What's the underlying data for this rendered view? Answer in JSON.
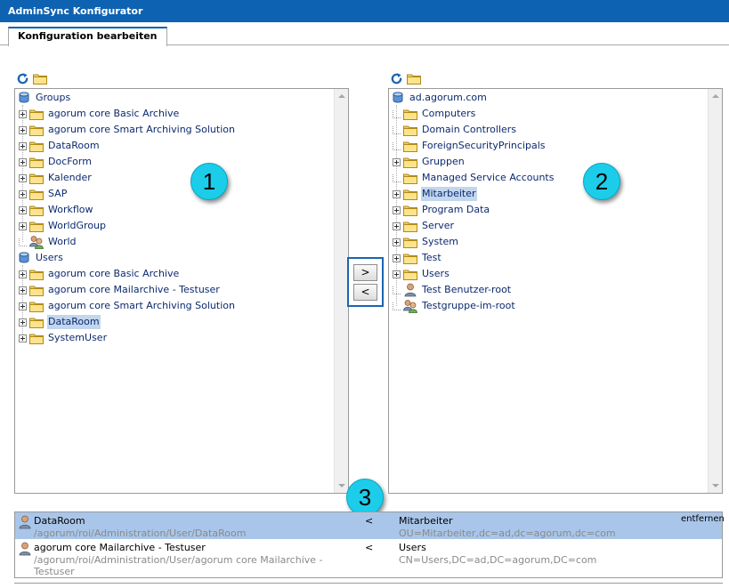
{
  "app": {
    "title": "AdminSync Konfigurator"
  },
  "tabs": [
    {
      "label": "Konfiguration bearbeiten"
    }
  ],
  "left_tree": {
    "rows": [
      {
        "label": "Groups",
        "icon": "server-icon",
        "level": 0,
        "expander": "none"
      },
      {
        "label": "agorum core Basic Archive",
        "icon": "folder-icon",
        "level": 1,
        "expander": "plus"
      },
      {
        "label": "agorum core Smart Archiving Solution",
        "icon": "folder-icon",
        "level": 1,
        "expander": "plus"
      },
      {
        "label": "DataRoom",
        "icon": "folder-icon",
        "level": 1,
        "expander": "plus"
      },
      {
        "label": "DocForm",
        "icon": "folder-icon",
        "level": 1,
        "expander": "plus"
      },
      {
        "label": "Kalender",
        "icon": "folder-icon",
        "level": 1,
        "expander": "plus"
      },
      {
        "label": "SAP",
        "icon": "folder-icon",
        "level": 1,
        "expander": "plus"
      },
      {
        "label": "Workflow",
        "icon": "folder-icon",
        "level": 1,
        "expander": "plus"
      },
      {
        "label": "WorldGroup",
        "icon": "folder-icon",
        "level": 1,
        "expander": "plus"
      },
      {
        "label": "World",
        "icon": "group-icon",
        "level": 1,
        "expander": "line"
      },
      {
        "label": "Users",
        "icon": "server-icon",
        "level": 0,
        "expander": "none"
      },
      {
        "label": "agorum core Basic Archive",
        "icon": "folder-icon",
        "level": 1,
        "expander": "plus"
      },
      {
        "label": "agorum core Mailarchive - Testuser",
        "icon": "folder-icon",
        "level": 1,
        "expander": "plus"
      },
      {
        "label": "agorum core Smart Archiving Solution",
        "icon": "folder-icon",
        "level": 1,
        "expander": "plus"
      },
      {
        "label": "DataRoom",
        "icon": "folder-icon",
        "level": 1,
        "expander": "plus",
        "selected": true
      },
      {
        "label": "SystemUser",
        "icon": "folder-icon",
        "level": 1,
        "expander": "plus"
      }
    ]
  },
  "right_tree": {
    "rows": [
      {
        "label": "ad.agorum.com",
        "icon": "server-icon",
        "level": 0,
        "expander": "none"
      },
      {
        "label": "Computers",
        "icon": "folder-icon",
        "level": 1,
        "expander": "line"
      },
      {
        "label": "Domain Controllers",
        "icon": "folder-icon",
        "level": 1,
        "expander": "line"
      },
      {
        "label": "ForeignSecurityPrincipals",
        "icon": "folder-icon",
        "level": 1,
        "expander": "line"
      },
      {
        "label": "Gruppen",
        "icon": "folder-icon",
        "level": 1,
        "expander": "plus"
      },
      {
        "label": "Managed Service Accounts",
        "icon": "folder-icon",
        "level": 1,
        "expander": "line"
      },
      {
        "label": "Mitarbeiter",
        "icon": "folder-icon",
        "level": 1,
        "expander": "plus",
        "selected": true
      },
      {
        "label": "Program Data",
        "icon": "folder-icon",
        "level": 1,
        "expander": "plus"
      },
      {
        "label": "Server",
        "icon": "folder-icon",
        "level": 1,
        "expander": "plus"
      },
      {
        "label": "System",
        "icon": "folder-icon",
        "level": 1,
        "expander": "plus"
      },
      {
        "label": "Test",
        "icon": "folder-icon",
        "level": 1,
        "expander": "plus"
      },
      {
        "label": "Users",
        "icon": "folder-icon",
        "level": 1,
        "expander": "plus"
      },
      {
        "label": "Test Benutzer-root",
        "icon": "user-icon",
        "level": 1,
        "expander": "line"
      },
      {
        "label": "Testgruppe-im-root",
        "icon": "group-icon",
        "level": 1,
        "expander": "line"
      }
    ]
  },
  "move_buttons": {
    "add": ">",
    "remove": "<"
  },
  "badges": {
    "one": "1",
    "two": "2",
    "three": "3"
  },
  "mappings": [
    {
      "name": "DataRoom",
      "path": "/agorum/roi/Administration/User/DataRoom",
      "direction": "<",
      "target": "Mitarbeiter",
      "target_dn": "OU=Mitarbeiter,dc=ad,dc=agorum,dc=com",
      "action": "entfernen",
      "selected": true
    },
    {
      "name": "agorum core Mailarchive - Testuser",
      "path_line1": "/agorum/roi/Administration/User/agorum core Mailarchive -",
      "path_line2": "Testuser",
      "direction": "<",
      "target": "Users",
      "target_dn": "CN=Users,DC=ad,DC=agorum,DC=com"
    }
  ]
}
